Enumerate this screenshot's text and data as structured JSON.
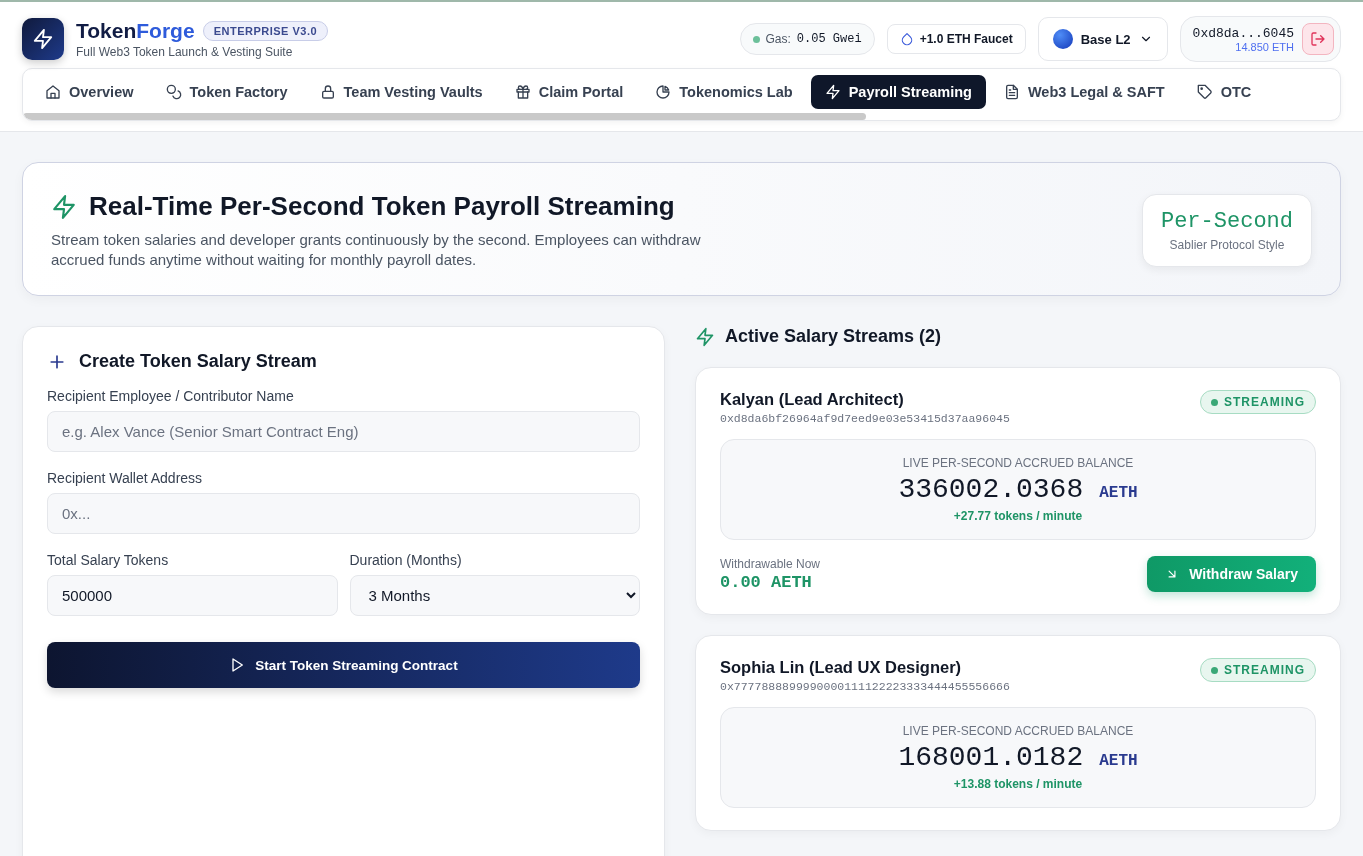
{
  "brand": {
    "name_a": "Token",
    "name_b": "Forge",
    "badge": "ENTERPRISE V3.0",
    "tagline": "Full Web3 Token Launch & Vesting Suite"
  },
  "header": {
    "gas_label": "Gas:",
    "gas_value": "0.05 Gwei",
    "faucet": "+1.0 ETH Faucet",
    "network": "Base L2",
    "wallet_address": "0xd8da...6045",
    "wallet_balance": "14.850 ETH"
  },
  "tabs": [
    {
      "label": "Overview",
      "selected": false
    },
    {
      "label": "Token Factory",
      "selected": false
    },
    {
      "label": "Team Vesting Vaults",
      "selected": false
    },
    {
      "label": "Claim Portal",
      "selected": false
    },
    {
      "label": "Tokenomics Lab",
      "selected": false
    },
    {
      "label": "Payroll Streaming",
      "selected": true
    },
    {
      "label": "Web3 Legal & SAFT",
      "selected": false
    },
    {
      "label": "OTC",
      "selected": false
    }
  ],
  "hero": {
    "title": "Real-Time Per-Second Token Payroll Streaming",
    "description": "Stream token salaries and developer grants continuously by the second. Employees can withdraw accrued funds anytime without waiting for monthly payroll dates.",
    "badge_title": "Per-Second",
    "badge_subtitle": "Sablier Protocol Style"
  },
  "form": {
    "title": "Create Token Salary Stream",
    "name_label": "Recipient Employee / Contributor Name",
    "name_placeholder": "e.g. Alex Vance (Senior Smart Contract Eng)",
    "wallet_label": "Recipient Wallet Address",
    "wallet_placeholder": "0x...",
    "tokens_label": "Total Salary Tokens",
    "tokens_value": "500000",
    "duration_label": "Duration (Months)",
    "duration_value": "3 Months",
    "submit": "Start Token Streaming Contract"
  },
  "streams_title": "Active Salary Streams (2)",
  "streams": [
    {
      "name": "Kalyan (Lead Architect)",
      "address": "0xd8da6bf26964af9d7eed9e03e53415d37aa96045",
      "status": "STREAMING",
      "balance_label": "LIVE PER-SECOND ACCRUED BALANCE",
      "balance": "336002.0368",
      "unit": "AETH",
      "rate": "+27.77 tokens / minute",
      "withdrawable_label": "Withdrawable Now",
      "withdrawable": "0.00 AETH",
      "withdraw_button": "Withdraw Salary"
    },
    {
      "name": "Sophia Lin (Lead UX Designer)",
      "address": "0x7777888899990000111122223333444455556666",
      "status": "STREAMING",
      "balance_label": "LIVE PER-SECOND ACCRUED BALANCE",
      "balance": "168001.0182",
      "unit": "AETH",
      "rate": "+13.88 tokens / minute"
    }
  ]
}
